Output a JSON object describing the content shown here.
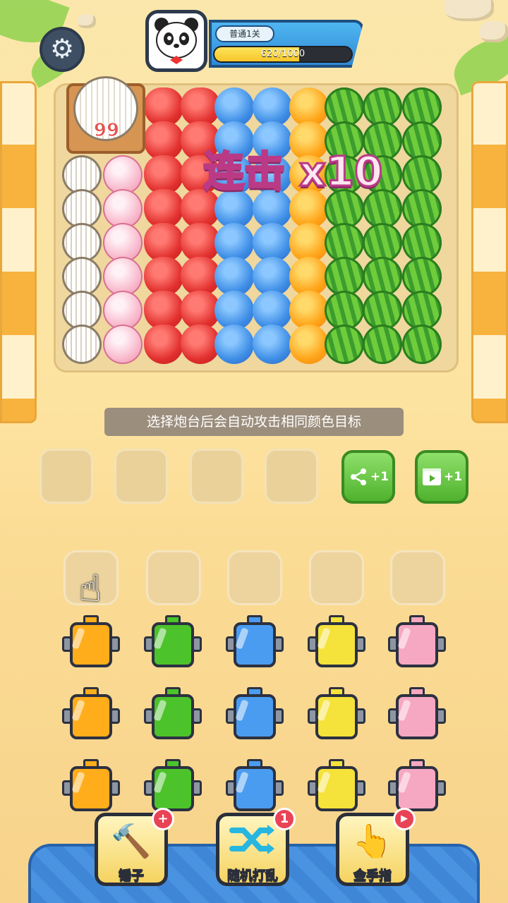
{
  "header": {
    "settings_icon": "gear-icon",
    "avatar_icon": "panda-avatar",
    "level_label": "普通1关",
    "progress_text": "620/1000",
    "progress_fraction": 0.62
  },
  "board": {
    "crate_count": "99",
    "combo_text": "连击 x10",
    "columns": [
      "melon",
      "peach",
      "strawberry",
      "strawberry",
      "blueberry",
      "blueberry",
      "orange",
      "watermelon",
      "watermelon",
      "watermelon"
    ]
  },
  "hint": "选择炮台后会自动攻击相同颜色目标",
  "action_buttons": {
    "share_label": "+1",
    "share_icon": "share-icon",
    "video_label": "+1",
    "video_icon": "video-icon"
  },
  "cannons": {
    "colors": [
      "#ffad1a",
      "#4cc32a",
      "#4a9cf0",
      "#f5e23a",
      "#f6a7c2"
    ],
    "rows": 3
  },
  "tools": [
    {
      "label": "锤子",
      "icon": "hammer-icon",
      "badge": "+"
    },
    {
      "label": "随机打乱",
      "icon": "shuffle-icon",
      "badge": "1"
    },
    {
      "label": "金手指",
      "icon": "golden-finger-icon",
      "badge": "▶"
    }
  ]
}
